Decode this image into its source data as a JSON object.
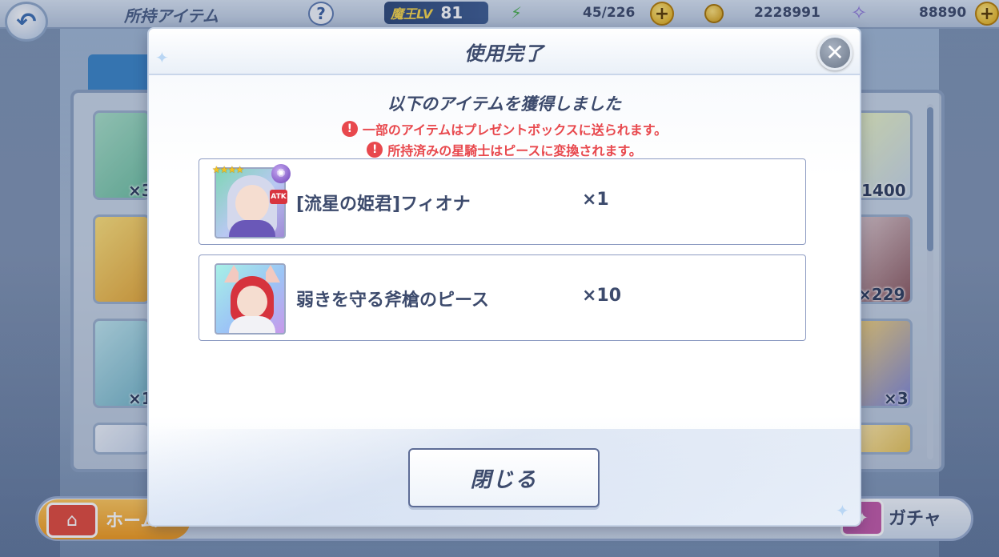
{
  "header": {
    "page_title": "所持アイテム",
    "help_icon": "question-icon",
    "level_label": "魔王LV",
    "level_value": "81",
    "stamina_icon": "lightning-icon",
    "stamina": "45/226",
    "coins": "2228991",
    "gems": "88890",
    "plus_label": "+"
  },
  "background": {
    "counts_left": [
      "×3",
      "×1"
    ],
    "counts_right": [
      "1400",
      "×229",
      "×3"
    ]
  },
  "nav": {
    "home_label": "ホーム",
    "gacha_label": "ガチャ"
  },
  "modal": {
    "title": "使用完了",
    "heading": "以下のアイテムを獲得しました",
    "notices": [
      "一部のアイテムはプレゼントボックスに送られます。",
      "所持済みの星騎士はピースに変換されます。"
    ],
    "rewards": [
      {
        "name": "[流星の姫君]フィオナ",
        "qty": "×1"
      },
      {
        "name": "弱きを守る斧槍のピース",
        "qty": "×10"
      }
    ],
    "close_button_label": "閉じる"
  },
  "colors": {
    "warning": "#e8484d",
    "text": "#3d4b6d",
    "card_border": "#8d9bc2",
    "accent_gold": "#f4c222"
  }
}
